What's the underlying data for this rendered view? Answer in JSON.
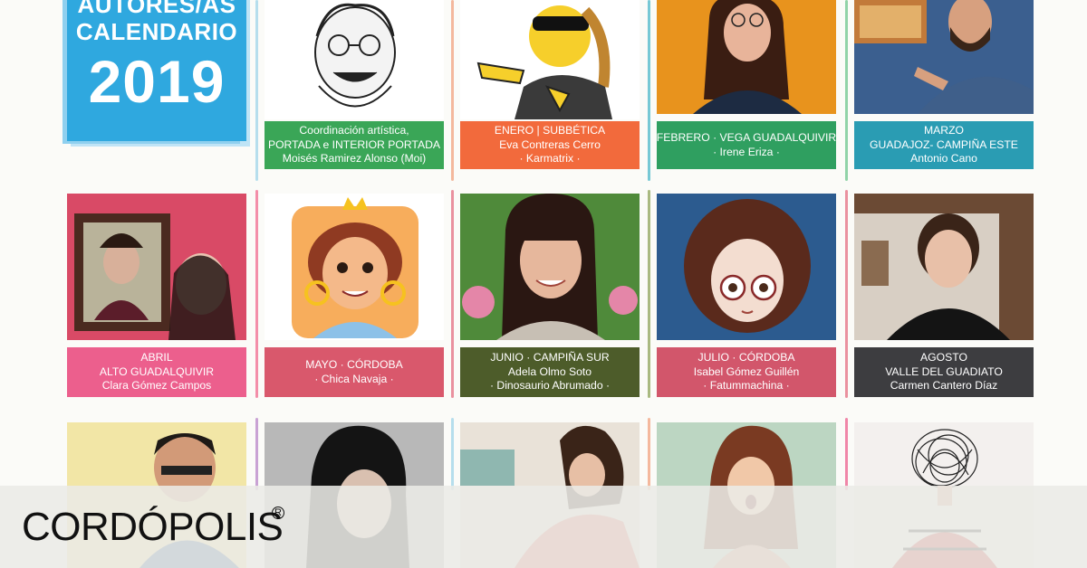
{
  "title_block": {
    "line1": "AUTORES/AS",
    "line2": "CALENDARIO",
    "year": "2019"
  },
  "row1": [
    {
      "lines": [
        "Coordinación artística,",
        "PORTADA e INTERIOR PORTADA",
        "Moisés Ramirez Alonso (Moi)"
      ],
      "color": "#3aa657"
    },
    {
      "lines": [
        "ENERO | SUBBÉTICA",
        "Eva Contreras Cerro",
        "· Karmatrix ·"
      ],
      "color": "#f26a3c"
    },
    {
      "lines": [
        "FEBRERO · VEGA GUADALQUIVIR",
        "· Irene Eriza ·"
      ],
      "color": "#2f9f60"
    },
    {
      "lines": [
        "MARZO",
        "GUADAJOZ- CAMPIÑA ESTE",
        "Antonio Cano"
      ],
      "color": "#2a9cb3"
    }
  ],
  "row2": [
    {
      "lines": [
        "ABRIL",
        "ALTO GUADALQUIVIR",
        "Clara Gómez Campos"
      ],
      "color": "#ec5f8d"
    },
    {
      "lines": [
        "MAYO · CÓRDOBA",
        "· Chica Navaja ·"
      ],
      "color": "#d9586c"
    },
    {
      "lines": [
        "JUNIO · CAMPIÑA SUR",
        "Adela Olmo Soto",
        "· Dinosaurio Abrumado ·"
      ],
      "color": "#4d5c2a"
    },
    {
      "lines": [
        "JULIO · CÓRDOBA",
        "Isabel Gómez Guillén",
        "· Fatummachina ·"
      ],
      "color": "#d2566b"
    },
    {
      "lines": [
        "AGOSTO",
        "VALLE DEL GUADIATO",
        "Carmen Cantero Díaz"
      ],
      "color": "#3d3d40"
    }
  ],
  "brand": {
    "logo": "CORDÓPOLIS",
    "reg": "R"
  }
}
